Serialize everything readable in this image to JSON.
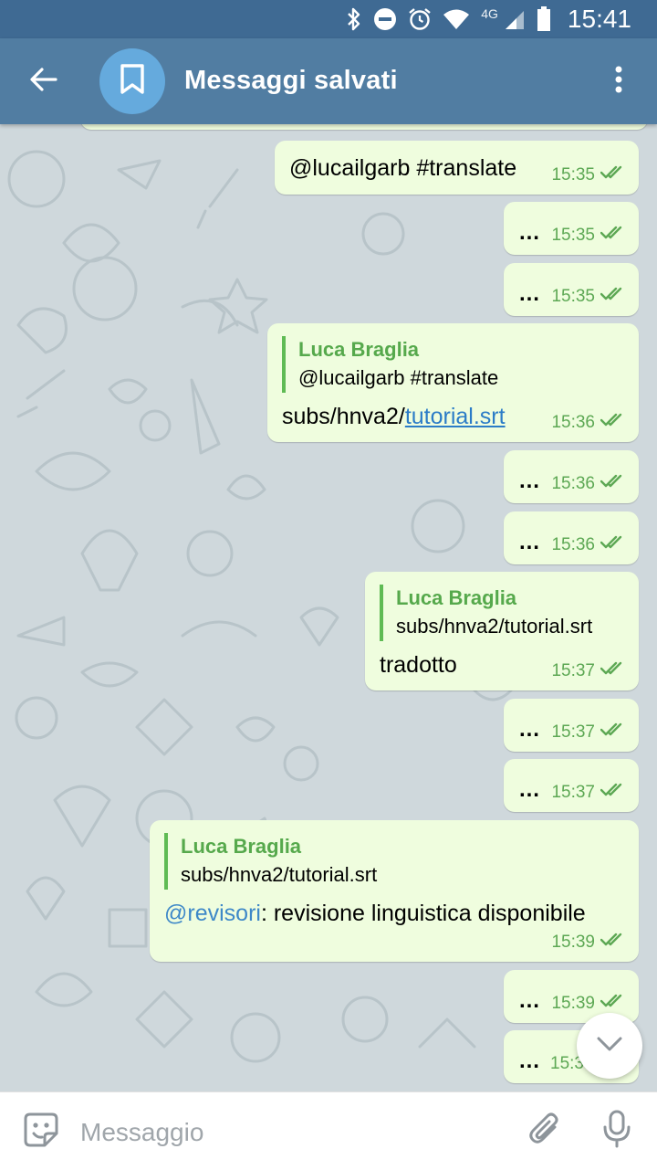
{
  "status_bar": {
    "network": "4G",
    "time": "15:41",
    "icons": [
      "bluetooth-icon",
      "do-not-disturb-icon",
      "alarm-icon",
      "wifi-icon",
      "signal-icon",
      "battery-icon"
    ]
  },
  "header": {
    "title": "Messaggi salvati",
    "avatar_icon": "bookmark-icon",
    "back_icon": "arrow-back-icon",
    "menu_icon": "more-vert-icon"
  },
  "messages": [
    {
      "text_mention": "@lucailgarb #translate",
      "time": "15:35"
    },
    {
      "text": "…",
      "time": "15:35"
    },
    {
      "text": "…",
      "time": "15:35"
    },
    {
      "reply_name": "Luca Braglia",
      "reply_text": "@lucailgarb #translate",
      "text_prefix": "subs/hnva2/",
      "text_link": "tutorial.srt",
      "time": "15:36"
    },
    {
      "text": "…",
      "time": "15:36"
    },
    {
      "text": "…",
      "time": "15:36"
    },
    {
      "reply_name": "Luca Braglia",
      "reply_text": "subs/hnva2/tutorial.srt",
      "text": "tradotto",
      "time": "15:37"
    },
    {
      "text": "…",
      "time": "15:37"
    },
    {
      "text": "…",
      "time": "15:37"
    },
    {
      "reply_name": "Luca Braglia",
      "reply_text": "subs/hnva2/tutorial.srt",
      "text_mention": "@revisori",
      "text_rest": ": revisione linguistica disponibile",
      "time": "15:39"
    },
    {
      "text": "…",
      "time": "15:39"
    },
    {
      "text": "…",
      "time": "15:3"
    }
  ],
  "input": {
    "placeholder": "Messaggio",
    "value": ""
  },
  "colors": {
    "status_bar": "#3f6a93",
    "app_bar": "#517da2",
    "avatar": "#65aadd",
    "bubble_out": "#effdde",
    "time_green": "#5da854",
    "reply_green": "#56a94c",
    "link_blue": "#2b7cc7"
  }
}
